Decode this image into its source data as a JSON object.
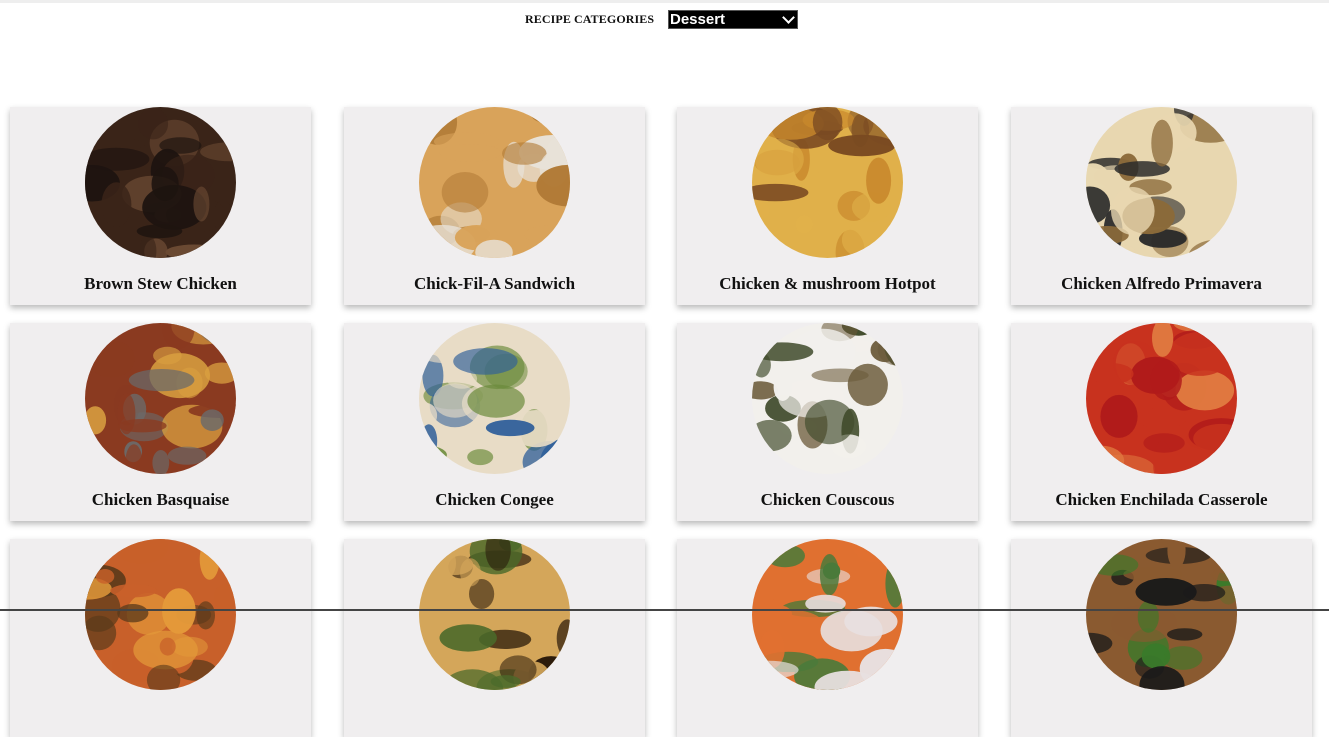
{
  "header": {
    "category_label": "RECIPE CATEGORIES",
    "category_selected": "Dessert"
  },
  "recipes": [
    {
      "title": "Brown Stew Chicken",
      "image": "brown-stew-chicken-photo",
      "colors": [
        "#3a2418",
        "#6b4a33",
        "#1e1410"
      ]
    },
    {
      "title": "Chick-Fil-A Sandwich",
      "image": "chick-fil-a-sandwich-photo",
      "colors": [
        "#d9a35a",
        "#b07a36",
        "#e8e2d8"
      ]
    },
    {
      "title": "Chicken & mushroom Hotpot",
      "image": "chicken-mushroom-hotpot-photo",
      "colors": [
        "#e0b04a",
        "#c9892c",
        "#7a4a22"
      ]
    },
    {
      "title": "Chicken Alfredo Primavera",
      "image": "chicken-alfredo-primavera-photo",
      "colors": [
        "#e8d7b0",
        "#2a2a2a",
        "#8b6a3a"
      ]
    },
    {
      "title": "Chicken Basquaise",
      "image": "chicken-basquaise-photo",
      "colors": [
        "#8a3a20",
        "#d9a040",
        "#6a6a6a"
      ]
    },
    {
      "title": "Chicken Congee",
      "image": "chicken-congee-photo",
      "colors": [
        "#e8dcc6",
        "#2f5f9a",
        "#6a8a3a"
      ]
    },
    {
      "title": "Chicken Couscous",
      "image": "chicken-couscous-photo",
      "colors": [
        "#f2f0ec",
        "#6b5a3a",
        "#3f4a2a"
      ]
    },
    {
      "title": "Chicken Enchilada Casserole",
      "image": "chicken-enchilada-casserole-photo",
      "colors": [
        "#c8321e",
        "#e07a40",
        "#b01a1a"
      ]
    },
    {
      "title": "",
      "image": "recipe-photo-9",
      "colors": [
        "#c8602a",
        "#e49a3a",
        "#5a3a1a"
      ]
    },
    {
      "title": "",
      "image": "recipe-photo-10",
      "colors": [
        "#d4a65a",
        "#4a6a2a",
        "#2a1a0a"
      ]
    },
    {
      "title": "",
      "image": "recipe-photo-11",
      "colors": [
        "#e07030",
        "#e8e0e0",
        "#4a7a3a"
      ]
    },
    {
      "title": "",
      "image": "recipe-photo-12",
      "colors": [
        "#8a5a30",
        "#3a7a2a",
        "#1a1a1a"
      ]
    }
  ]
}
